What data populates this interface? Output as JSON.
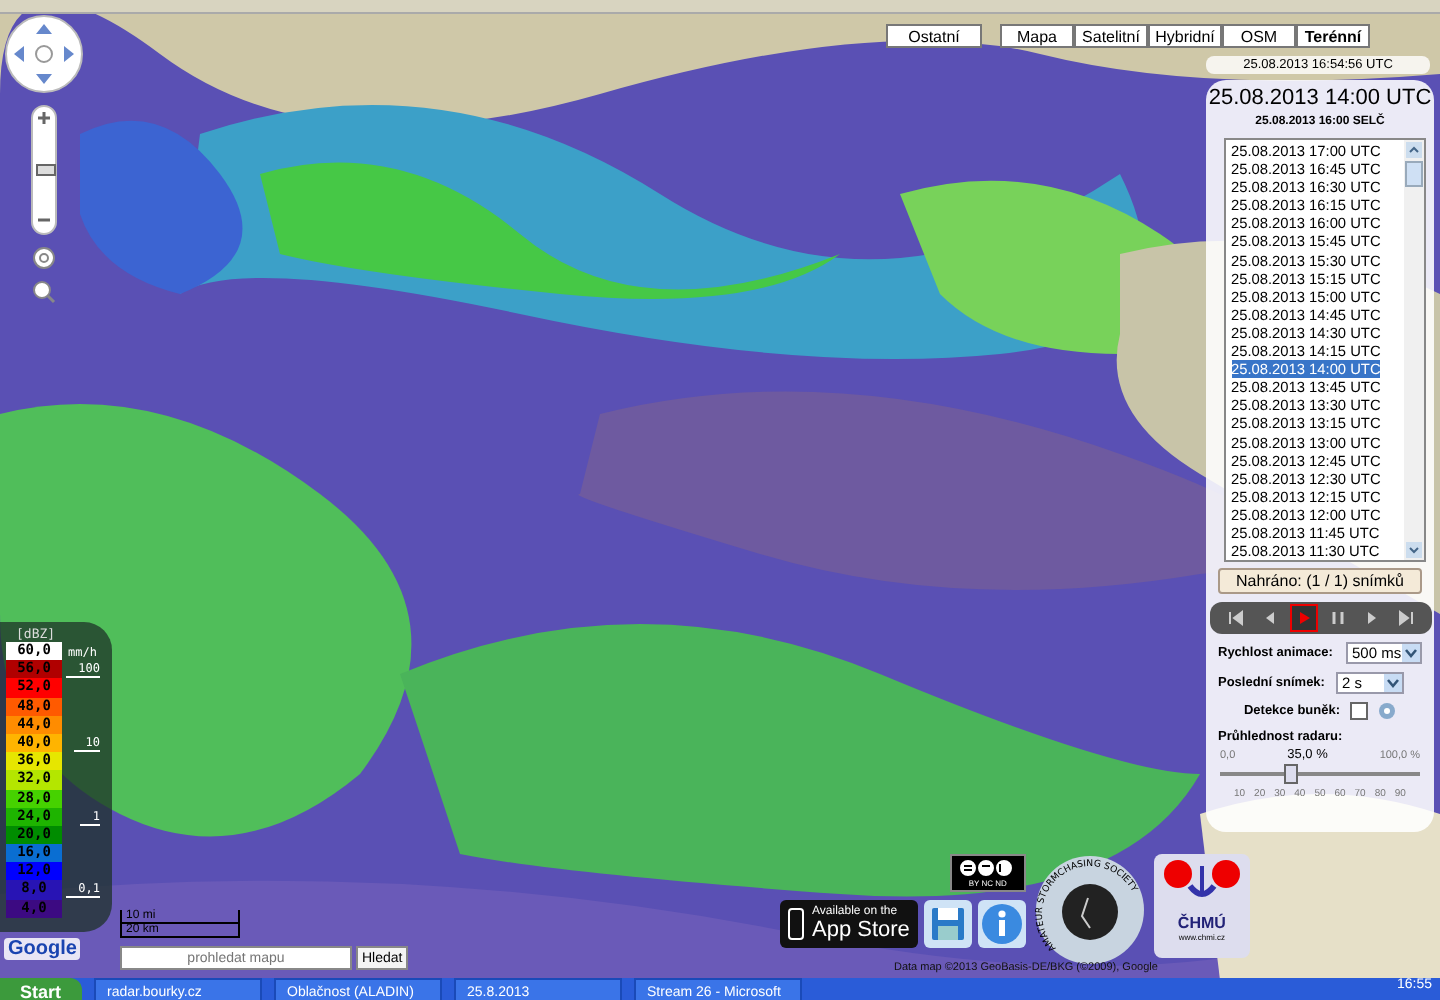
{
  "zoom": {
    "level": 0.45
  },
  "map_types": [
    {
      "label": "Ostatní",
      "selected": false,
      "kind": "single"
    },
    {
      "label": "Mapa",
      "selected": false,
      "kind": "group"
    },
    {
      "label": "Satelitní",
      "selected": false,
      "kind": "group"
    },
    {
      "label": "Hybridní",
      "selected": false,
      "kind": "group"
    },
    {
      "label": "OSM",
      "selected": false,
      "kind": "group"
    },
    {
      "label": "Terénní",
      "selected": true,
      "kind": "group"
    }
  ],
  "timestamp": "25.08.2013 16:54:56 UTC",
  "panel": {
    "title": "25.08.2013 14:00 UTC",
    "subtitle": "25.08.2013 16:00 SELČ",
    "times": [
      {
        "label": "25.08.2013 17:00 UTC",
        "selected": false
      },
      {
        "label": "25.08.2013 16:45 UTC",
        "selected": false
      },
      {
        "label": "25.08.2013 16:30 UTC",
        "selected": false
      },
      {
        "label": "25.08.2013 16:15 UTC",
        "selected": false
      },
      {
        "label": "25.08.2013 16:00 UTC",
        "selected": false
      },
      {
        "label": "25.08.2013 15:45 UTC",
        "selected": false
      },
      {
        "label": "25.08.2013 15:30 UTC",
        "selected": false
      },
      {
        "label": "25.08.2013 15:15 UTC",
        "selected": false
      },
      {
        "label": "25.08.2013 15:00 UTC",
        "selected": false
      },
      {
        "label": "25.08.2013 14:45 UTC",
        "selected": false
      },
      {
        "label": "25.08.2013 14:30 UTC",
        "selected": false
      },
      {
        "label": "25.08.2013 14:15 UTC",
        "selected": false
      },
      {
        "label": "25.08.2013 14:00 UTC",
        "selected": true
      },
      {
        "label": "25.08.2013 13:45 UTC",
        "selected": false
      },
      {
        "label": "25.08.2013 13:30 UTC",
        "selected": false
      },
      {
        "label": "25.08.2013 13:15 UTC",
        "selected": false
      },
      {
        "label": "25.08.2013 13:00 UTC",
        "selected": false
      },
      {
        "label": "25.08.2013 12:45 UTC",
        "selected": false
      },
      {
        "label": "25.08.2013 12:30 UTC",
        "selected": false
      },
      {
        "label": "25.08.2013 12:15 UTC",
        "selected": false
      },
      {
        "label": "25.08.2013 12:00 UTC",
        "selected": false
      },
      {
        "label": "25.08.2013 11:45 UTC",
        "selected": false
      },
      {
        "label": "25.08.2013 11:30 UTC",
        "selected": false
      }
    ],
    "loaded_button": "Nahráno: (1 / 1) snímků",
    "playback": [
      {
        "kind": "first",
        "selected": false
      },
      {
        "kind": "prev",
        "selected": false
      },
      {
        "kind": "play",
        "selected": true
      },
      {
        "kind": "pause",
        "selected": false
      },
      {
        "kind": "next",
        "selected": false
      },
      {
        "kind": "last",
        "selected": false
      }
    ],
    "speed": {
      "label": "Rychlost animace:",
      "value": "500 ms"
    },
    "last_frame": {
      "label": "Poslední snímek:",
      "value": "2 s"
    },
    "cell_detection": {
      "label": "Detekce buněk:",
      "checked": false
    },
    "transparency": {
      "label": "Průhlednost radaru:",
      "min": "0,0",
      "value_label": "35,0 %",
      "max": "100,0 %",
      "level": 0.35,
      "ticks": [
        "10",
        "20",
        "30",
        "40",
        "50",
        "60",
        "70",
        "80",
        "90"
      ]
    }
  },
  "legend": {
    "unit": "[dBZ]",
    "rain_unit": "mm/h",
    "items": [
      {
        "value": "60,0",
        "color": "#ffffff"
      },
      {
        "value": "56,0",
        "color": "#b00000",
        "rain_label": "100"
      },
      {
        "value": "52,0",
        "color": "#ff0000"
      },
      {
        "value": "48,0",
        "color": "#ff5a00"
      },
      {
        "value": "44,0",
        "color": "#ff8c00"
      },
      {
        "value": "40,0",
        "color": "#ffb400",
        "rain_label": "10"
      },
      {
        "value": "36,0",
        "color": "#e6e600"
      },
      {
        "value": "32,0",
        "color": "#b4e600"
      },
      {
        "value": "28,0",
        "color": "#46d200"
      },
      {
        "value": "24,0",
        "color": "#1eb400",
        "rain_label": "1"
      },
      {
        "value": "20,0",
        "color": "#008c00"
      },
      {
        "value": "16,0",
        "color": "#0a6ed2"
      },
      {
        "value": "12,0",
        "color": "#0000ff"
      },
      {
        "value": "8,0",
        "color": "#2814b4",
        "rain_label": "0,1"
      },
      {
        "value": "4,0",
        "color": "#3c0a82"
      }
    ]
  },
  "scale": {
    "miles": "10 mi",
    "km": "20 km"
  },
  "google": "Google",
  "search": {
    "placeholder": "prohledat mapu",
    "button": "Hledat"
  },
  "cc_badge": "BY NC ND",
  "app_store": {
    "small": "Available on the",
    "big": "App Store"
  },
  "society_logo": "AMATEUR STORMCHASING SOCIETY",
  "chmu_logo": {
    "name": "ČHMÚ",
    "url": "www.chmi.cz"
  },
  "attribution": "Data map ©2013 GeoBasis-DE/BKG (©2009), Google",
  "taskbar": {
    "start": "Start",
    "tasks": [
      "radar.bourky.cz",
      "Oblačnost (ALADIN)",
      "25.8.2013",
      "Stream 26 - Microsoft"
    ],
    "clock": "16:55"
  }
}
